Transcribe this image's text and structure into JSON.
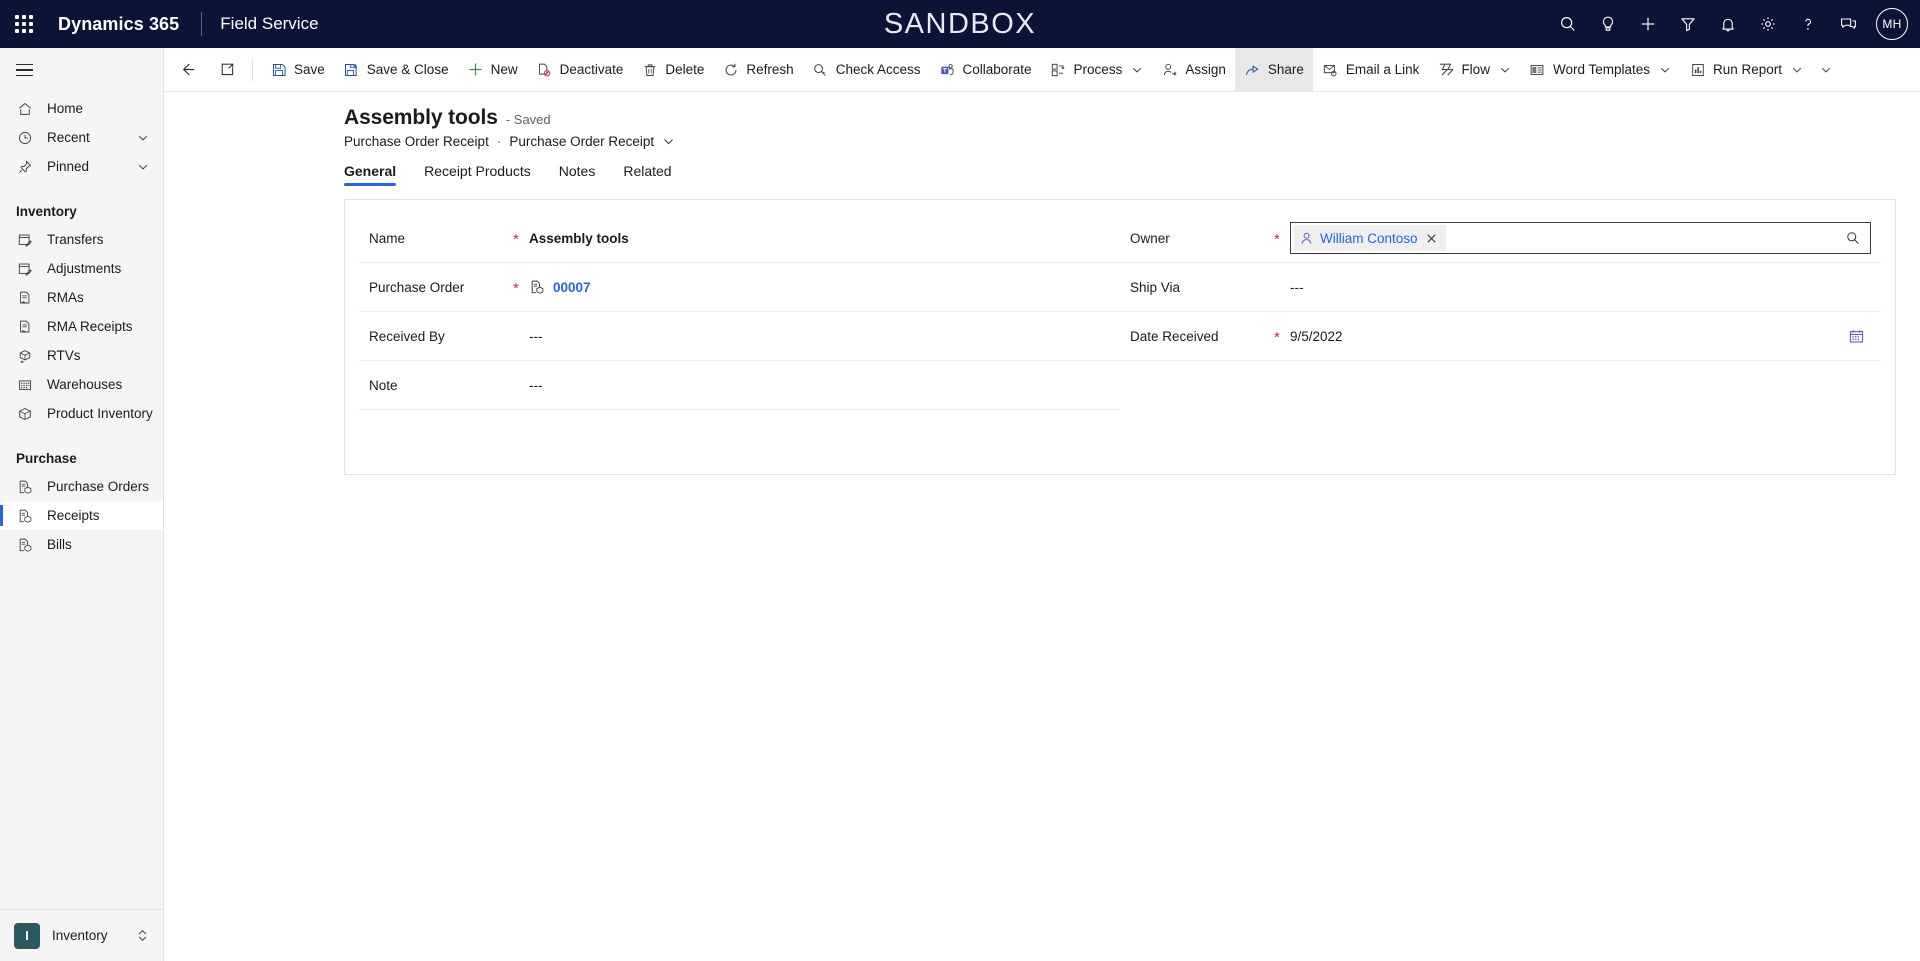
{
  "topbar": {
    "waffle_icon": "app-launcher-icon",
    "brand": "Dynamics 365",
    "app_name": "Field Service",
    "environment_banner": "SANDBOX",
    "actions": [
      {
        "name": "search-icon",
        "label": "Search"
      },
      {
        "name": "lightbulb-icon",
        "label": "Ideas"
      },
      {
        "name": "plus-icon",
        "label": "New"
      },
      {
        "name": "filter-icon",
        "label": "Filter"
      },
      {
        "name": "bell-icon",
        "label": "Notifications"
      },
      {
        "name": "gear-icon",
        "label": "Settings"
      },
      {
        "name": "help-icon",
        "label": "Help"
      },
      {
        "name": "feedback-icon",
        "label": "Feedback"
      }
    ],
    "avatar_initials": "MH"
  },
  "sidebar": {
    "hamburger_label": "Expand navigation",
    "items": [
      {
        "label": "Home",
        "icon": "home-icon",
        "chevron": false,
        "selected": false
      },
      {
        "label": "Recent",
        "icon": "clock-icon",
        "chevron": true,
        "selected": false
      },
      {
        "label": "Pinned",
        "icon": "pin-icon",
        "chevron": true,
        "selected": false
      }
    ],
    "groups": [
      {
        "header": "Inventory",
        "items": [
          {
            "label": "Transfers",
            "icon": "transfer-icon",
            "selected": false
          },
          {
            "label": "Adjustments",
            "icon": "adjustment-icon",
            "selected": false
          },
          {
            "label": "RMAs",
            "icon": "rma-icon",
            "selected": false
          },
          {
            "label": "RMA Receipts",
            "icon": "rma-receipt-icon",
            "selected": false
          },
          {
            "label": "RTVs",
            "icon": "rtv-icon",
            "selected": false
          },
          {
            "label": "Warehouses",
            "icon": "warehouse-icon",
            "selected": false
          },
          {
            "label": "Product Inventory",
            "icon": "box-icon",
            "selected": false
          }
        ]
      },
      {
        "header": "Purchase",
        "items": [
          {
            "label": "Purchase Orders",
            "icon": "purchase-order-icon",
            "selected": false
          },
          {
            "label": "Receipts",
            "icon": "receipt-icon",
            "selected": true
          },
          {
            "label": "Bills",
            "icon": "bill-icon",
            "selected": false
          }
        ]
      }
    ],
    "area_switcher": {
      "badge": "I",
      "label": "Inventory",
      "chevron_icon": "updown-chevron-icon"
    }
  },
  "commandbar": {
    "back_label": "Back",
    "popout_label": "Open in new window",
    "buttons": [
      {
        "label": "Save",
        "icon": "save-icon",
        "chevron": false,
        "active": false
      },
      {
        "label": "Save & Close",
        "icon": "save-close-icon",
        "chevron": false,
        "active": false
      },
      {
        "label": "New",
        "icon": "plus-icon",
        "chevron": false,
        "active": false
      },
      {
        "label": "Deactivate",
        "icon": "deactivate-icon",
        "chevron": false,
        "active": false
      },
      {
        "label": "Delete",
        "icon": "trash-icon",
        "chevron": false,
        "active": false
      },
      {
        "label": "Refresh",
        "icon": "refresh-icon",
        "chevron": false,
        "active": false
      },
      {
        "label": "Check Access",
        "icon": "check-access-icon",
        "chevron": false,
        "active": false
      },
      {
        "label": "Collaborate",
        "icon": "teams-icon",
        "chevron": false,
        "active": false
      },
      {
        "label": "Process",
        "icon": "process-icon",
        "chevron": true,
        "active": false
      },
      {
        "label": "Assign",
        "icon": "assign-icon",
        "chevron": false,
        "active": false
      },
      {
        "label": "Share",
        "icon": "share-icon",
        "chevron": false,
        "active": true
      },
      {
        "label": "Email a Link",
        "icon": "email-link-icon",
        "chevron": false,
        "active": false
      },
      {
        "label": "Flow",
        "icon": "flow-icon",
        "chevron": true,
        "active": false
      },
      {
        "label": "Word Templates",
        "icon": "word-template-icon",
        "chevron": true,
        "active": false
      },
      {
        "label": "Run Report",
        "icon": "report-icon",
        "chevron": true,
        "active": false
      }
    ],
    "overflow_label": "More commands"
  },
  "record": {
    "title": "Assembly tools",
    "status": "- Saved",
    "breadcrumb_entity": "Purchase Order Receipt",
    "breadcrumb_sep": "·",
    "breadcrumb_form": "Purchase Order Receipt"
  },
  "tabs": [
    {
      "label": "General",
      "active": true
    },
    {
      "label": "Receipt Products",
      "active": false
    },
    {
      "label": "Notes",
      "active": false
    },
    {
      "label": "Related",
      "active": false
    }
  ],
  "form": {
    "left": [
      {
        "label": "Name",
        "required": true,
        "value": "Assembly tools",
        "type": "text-bold"
      },
      {
        "label": "Purchase Order",
        "required": true,
        "value": "00007",
        "type": "lookup-link",
        "icon": "purchase-order-icon"
      },
      {
        "label": "Received By",
        "required": false,
        "value": "---",
        "type": "text"
      },
      {
        "label": "Note",
        "required": false,
        "value": "---",
        "type": "text"
      }
    ],
    "right": [
      {
        "label": "Owner",
        "required": true,
        "value": "William Contoso",
        "type": "lookup-focused",
        "chip_icon": "person-icon",
        "remove_icon": "close-icon",
        "search_icon": "search-icon"
      },
      {
        "label": "Ship Via",
        "required": false,
        "value": "---",
        "type": "text"
      },
      {
        "label": "Date Received",
        "required": true,
        "value": "9/5/2022",
        "type": "date",
        "calendar_icon": "calendar-icon"
      }
    ]
  },
  "colors": {
    "topbar_bg": "#0b1437",
    "accent": "#2266e3",
    "required": "#c4314b",
    "sidebar_bg": "#f5f5f5",
    "area_badge": "#2b5a5e"
  }
}
